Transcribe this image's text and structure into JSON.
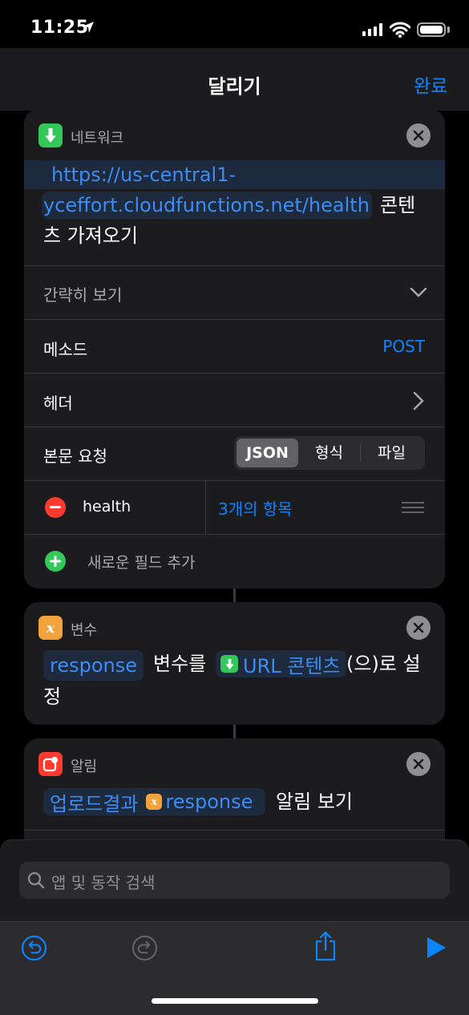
{
  "status_bar": {
    "time": "11:25"
  },
  "nav": {
    "title": "달리기",
    "done_label": "완료"
  },
  "network_action": {
    "name": "네트워크",
    "url_part1": "https://us-central1-",
    "url_part2": "yceffort.cloudfunctions.net/health",
    "suffix_1": "콘텐",
    "suffix_2": "츠 가져오기",
    "show_less": "간략히 보기",
    "method_label": "메소드",
    "method_value": "POST",
    "headers_label": "헤더",
    "body_label": "본문 요청",
    "body_options": [
      "JSON",
      "형식",
      "파일"
    ],
    "body_selected": "JSON",
    "field_key": "health",
    "field_value": "3개의 항목",
    "add_field": "새로운 필드 추가"
  },
  "variable_action": {
    "name": "변수",
    "var_name": "response",
    "text_1": "변수를",
    "token_label": "URL 콘텐츠",
    "text_2": "(으)로 설",
    "text_3": "정"
  },
  "notification_action": {
    "name": "알림",
    "token_title": "업로드결과",
    "token_var": "response",
    "text": "알림 보기"
  },
  "search": {
    "placeholder": "앱 및 동작 검색"
  },
  "colors": {
    "accent": "#0a84ff",
    "network_green": "#34c759",
    "variable_orange": "#f2a33a",
    "notification_red": "#ff3b30"
  },
  "icons": [
    "download-icon",
    "variable-icon",
    "notification-icon",
    "close-icon",
    "chevron-down-icon",
    "chevron-right-icon",
    "minus-icon",
    "plus-icon",
    "search-icon",
    "undo-icon",
    "redo-icon",
    "share-icon",
    "play-icon"
  ]
}
